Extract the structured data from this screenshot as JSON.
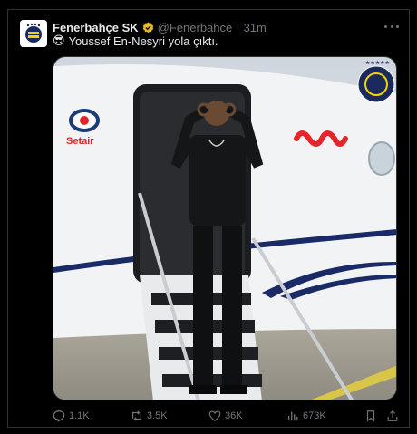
{
  "tweet": {
    "author_name": "Fenerbahçe SK",
    "handle": "@Fenerbahce",
    "separator": "·",
    "time": "31m",
    "emoji": "😎",
    "text": "Youssef En-Nesyri yola çıktı."
  },
  "media": {
    "logo_text": "Setair",
    "alt_icon": "sunglasses-emoji",
    "brand_colors": {
      "setair_red": "#e4262c",
      "setair_blue": "#1a3a7a",
      "fb_navy": "#1b2a5c",
      "fb_yellow": "#f4d400"
    }
  },
  "actions": {
    "reply_count": "1.1K",
    "retweet_count": "3.5K",
    "like_count": "36K",
    "view_count": "673K"
  },
  "icons": [
    "verified-badge-icon",
    "more-icon",
    "reply-icon",
    "retweet-icon",
    "like-icon",
    "views-icon",
    "bookmark-icon",
    "share-icon"
  ]
}
